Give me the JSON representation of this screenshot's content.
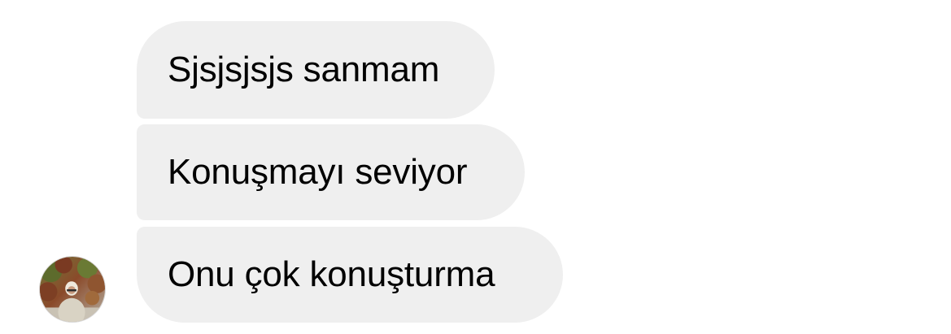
{
  "conversation": {
    "messages": [
      {
        "text": "Sjsjsjsjs sanmam"
      },
      {
        "text": "Konuşmayı seviyor"
      },
      {
        "text": "Onu çok konuşturma"
      }
    ],
    "sender_avatar": {
      "icon": "profile-photo"
    }
  },
  "colors": {
    "bubble_background": "#efefef",
    "text": "#000000",
    "page_background": "#ffffff"
  }
}
